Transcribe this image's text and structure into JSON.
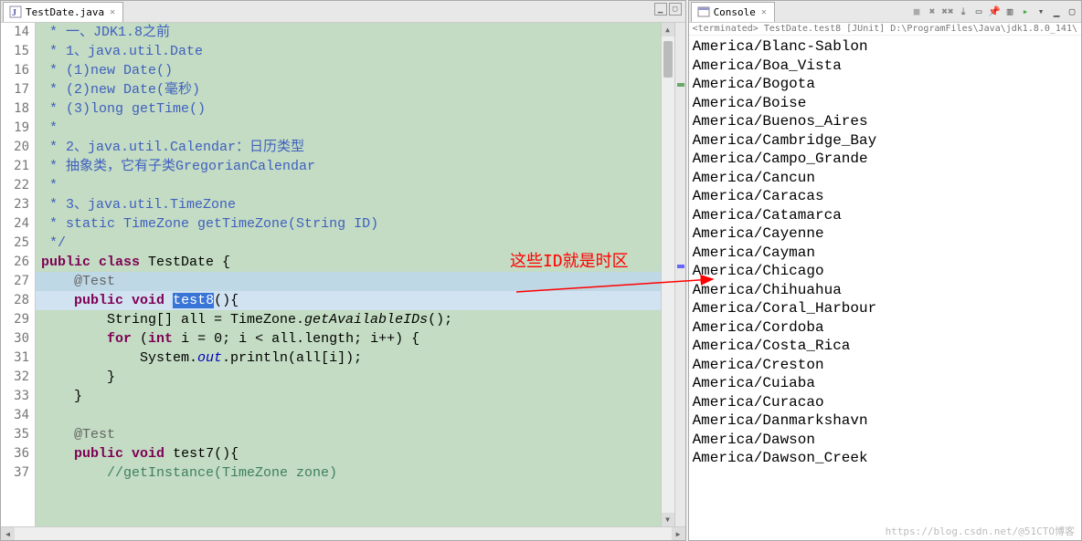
{
  "editor": {
    "tab_label": "TestDate.java",
    "lines": [
      {
        "num": "14",
        "html": " <span class='comment'>* 一、JDK1.8之前</span>"
      },
      {
        "num": "15",
        "html": " <span class='comment'>* 1、java.util.Date</span>"
      },
      {
        "num": "16",
        "html": " <span class='comment'>* (1)new Date()</span>"
      },
      {
        "num": "17",
        "html": " <span class='comment'>* (2)new Date(毫秒)</span>"
      },
      {
        "num": "18",
        "html": " <span class='comment'>* (3)long getTime()</span>"
      },
      {
        "num": "19",
        "html": " <span class='comment'>*</span>"
      },
      {
        "num": "20",
        "html": " <span class='comment'>* 2、java.util.Calendar：日历类型</span>"
      },
      {
        "num": "21",
        "html": " <span class='comment'>* 抽象类，它有子类GregorianCalendar</span>"
      },
      {
        "num": "22",
        "html": " <span class='comment'>*</span>"
      },
      {
        "num": "23",
        "html": " <span class='comment'>* 3、java.util.TimeZone</span>"
      },
      {
        "num": "24",
        "html": " <span class='comment'>* static TimeZone getTimeZone(String ID)</span>"
      },
      {
        "num": "25",
        "html": " <span class='comment'>*/</span>"
      },
      {
        "num": "26",
        "html": "<span class='kw'>public</span> <span class='kw'>class</span> TestDate {"
      },
      {
        "num": "27",
        "html": "    <span class='ann'>@Test</span>",
        "cls": "hl-cyan"
      },
      {
        "num": "28",
        "html": "    <span class='kw'>public</span> <span class='kw'>void</span> <span class='sel'>test8</span>(){",
        "cls": "hl-blue"
      },
      {
        "num": "29",
        "html": "        String[] all = TimeZone.<span class='method-call'>getAvailableIDs</span>();"
      },
      {
        "num": "30",
        "html": "        <span class='kw'>for</span> (<span class='kw'>int</span> i = 0; i &lt; all.length; i++) {"
      },
      {
        "num": "31",
        "html": "            System.<span class='static-field'>out</span>.println(all[i]);"
      },
      {
        "num": "32",
        "html": "        }"
      },
      {
        "num": "33",
        "html": "    }"
      },
      {
        "num": "34",
        "html": ""
      },
      {
        "num": "35",
        "html": "    <span class='ann'>@Test</span>"
      },
      {
        "num": "36",
        "html": "    <span class='kw'>public</span> <span class='kw'>void</span> test7(){"
      },
      {
        "num": "37",
        "html": "        <span class='comment-green'>//getInstance(TimeZone zone)</span>"
      }
    ]
  },
  "annotation_text": "这些ID就是时区",
  "console": {
    "tab_label": "Console",
    "status": "<terminated> TestDate.test8 [JUnit] D:\\ProgramFiles\\Java\\jdk1.8.0_141\\",
    "output": [
      "America/Blanc-Sablon",
      "America/Boa_Vista",
      "America/Bogota",
      "America/Boise",
      "America/Buenos_Aires",
      "America/Cambridge_Bay",
      "America/Campo_Grande",
      "America/Cancun",
      "America/Caracas",
      "America/Catamarca",
      "America/Cayenne",
      "America/Cayman",
      "America/Chicago",
      "America/Chihuahua",
      "America/Coral_Harbour",
      "America/Cordoba",
      "America/Costa_Rica",
      "America/Creston",
      "America/Cuiaba",
      "America/Curacao",
      "America/Danmarkshavn",
      "America/Dawson",
      "America/Dawson_Creek"
    ]
  },
  "watermark": "https://blog.csdn.net/@51CTO博客"
}
